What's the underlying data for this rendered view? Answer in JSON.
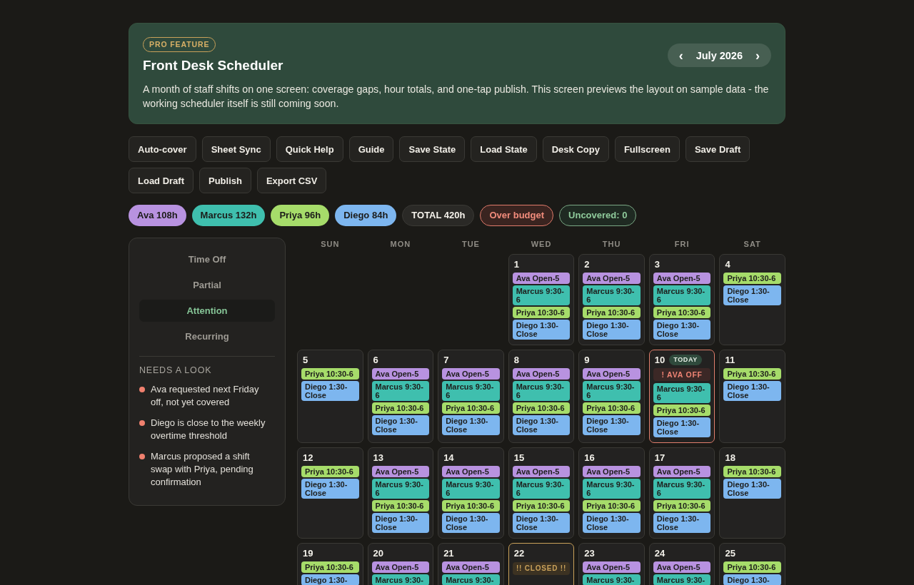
{
  "header": {
    "badge": "PRO FEATURE",
    "title": "Front Desk Scheduler",
    "description": "A month of staff shifts on one screen: coverage gaps, hour totals, and one-tap publish. This screen previews the layout on sample data - the working scheduler itself is still coming soon.",
    "month_nav": {
      "prev": "‹",
      "label": "July 2026",
      "next": "›"
    }
  },
  "toolbar": [
    "Auto-cover",
    "Sheet Sync",
    "Quick Help",
    "Guide",
    "Save State",
    "Load State",
    "Desk Copy",
    "Fullscreen",
    "Save Draft",
    "Load Draft",
    "Publish",
    "Export CSV"
  ],
  "hour_chips": [
    {
      "kind": "staff",
      "label": "Ava 108h",
      "color": "#b892e0"
    },
    {
      "kind": "staff",
      "label": "Marcus 132h",
      "color": "#3fbfae"
    },
    {
      "kind": "staff",
      "label": "Priya 96h",
      "color": "#a6dc6a"
    },
    {
      "kind": "staff",
      "label": "Diego 84h",
      "color": "#7db6ef"
    },
    {
      "kind": "total",
      "label": "TOTAL 420h"
    },
    {
      "kind": "alert",
      "label": "Over budget"
    },
    {
      "kind": "ok",
      "label": "Uncovered: 0"
    }
  ],
  "sidebar": {
    "filters": [
      {
        "label": "Time Off",
        "selected": false
      },
      {
        "label": "Partial",
        "selected": false
      },
      {
        "label": "Attention",
        "selected": true
      },
      {
        "label": "Recurring",
        "selected": false
      }
    ],
    "notices_heading": "NEEDS A LOOK",
    "notices": [
      "Ava requested next Friday off, not yet covered",
      "Diego is close to the weekly overtime threshold",
      "Marcus proposed a shift swap with Priya, pending confirmation"
    ]
  },
  "calendar": {
    "weekdays": [
      "SUN",
      "MON",
      "TUE",
      "WED",
      "THU",
      "FRI",
      "SAT"
    ],
    "weeks": [
      [
        {
          "kind": "blank"
        },
        {
          "kind": "blank"
        },
        {
          "kind": "blank"
        },
        {
          "kind": "day",
          "day": "1",
          "shifts": [
            {
              "kind": "shift",
              "label": "Ava Open-5",
              "color": "#b892e0"
            },
            {
              "kind": "shift",
              "label": "Marcus 9:30-6",
              "color": "#3fbfae"
            },
            {
              "kind": "shift",
              "label": "Priya 10:30-6",
              "color": "#a6dc6a"
            },
            {
              "kind": "shift",
              "label": "Diego 1:30-Close",
              "color": "#7db6ef"
            }
          ]
        },
        {
          "kind": "day",
          "day": "2",
          "shifts": [
            {
              "kind": "shift",
              "label": "Ava Open-5",
              "color": "#b892e0"
            },
            {
              "kind": "shift",
              "label": "Marcus 9:30-6",
              "color": "#3fbfae"
            },
            {
              "kind": "shift",
              "label": "Priya 10:30-6",
              "color": "#a6dc6a"
            },
            {
              "kind": "shift",
              "label": "Diego 1:30-Close",
              "color": "#7db6ef"
            }
          ]
        },
        {
          "kind": "day",
          "day": "3",
          "shifts": [
            {
              "kind": "shift",
              "label": "Ava Open-5",
              "color": "#b892e0"
            },
            {
              "kind": "shift",
              "label": "Marcus 9:30-6",
              "color": "#3fbfae"
            },
            {
              "kind": "shift",
              "label": "Priya 10:30-6",
              "color": "#a6dc6a"
            },
            {
              "kind": "shift",
              "label": "Diego 1:30-Close",
              "color": "#7db6ef"
            }
          ]
        },
        {
          "kind": "day",
          "day": "4",
          "shifts": [
            {
              "kind": "shift",
              "label": "Priya 10:30-6",
              "color": "#a6dc6a"
            },
            {
              "kind": "shift",
              "label": "Diego 1:30-Close",
              "color": "#7db6ef"
            }
          ]
        }
      ],
      [
        {
          "kind": "day",
          "day": "5",
          "shifts": [
            {
              "kind": "shift",
              "label": "Priya 10:30-6",
              "color": "#a6dc6a"
            },
            {
              "kind": "shift",
              "label": "Diego 1:30-Close",
              "color": "#7db6ef"
            }
          ]
        },
        {
          "kind": "day",
          "day": "6",
          "shifts": [
            {
              "kind": "shift",
              "label": "Ava Open-5",
              "color": "#b892e0"
            },
            {
              "kind": "shift",
              "label": "Marcus 9:30-6",
              "color": "#3fbfae"
            },
            {
              "kind": "shift",
              "label": "Priya 10:30-6",
              "color": "#a6dc6a"
            },
            {
              "kind": "shift",
              "label": "Diego 1:30-Close",
              "color": "#7db6ef"
            }
          ]
        },
        {
          "kind": "day",
          "day": "7",
          "shifts": [
            {
              "kind": "shift",
              "label": "Ava Open-5",
              "color": "#b892e0"
            },
            {
              "kind": "shift",
              "label": "Marcus 9:30-6",
              "color": "#3fbfae"
            },
            {
              "kind": "shift",
              "label": "Priya 10:30-6",
              "color": "#a6dc6a"
            },
            {
              "kind": "shift",
              "label": "Diego 1:30-Close",
              "color": "#7db6ef"
            }
          ]
        },
        {
          "kind": "day",
          "day": "8",
          "shifts": [
            {
              "kind": "shift",
              "label": "Ava Open-5",
              "color": "#b892e0"
            },
            {
              "kind": "shift",
              "label": "Marcus 9:30-6",
              "color": "#3fbfae"
            },
            {
              "kind": "shift",
              "label": "Priya 10:30-6",
              "color": "#a6dc6a"
            },
            {
              "kind": "shift",
              "label": "Diego 1:30-Close",
              "color": "#7db6ef"
            }
          ]
        },
        {
          "kind": "day",
          "day": "9",
          "shifts": [
            {
              "kind": "shift",
              "label": "Ava Open-5",
              "color": "#b892e0"
            },
            {
              "kind": "shift",
              "label": "Marcus 9:30-6",
              "color": "#3fbfae"
            },
            {
              "kind": "shift",
              "label": "Priya 10:30-6",
              "color": "#a6dc6a"
            },
            {
              "kind": "shift",
              "label": "Diego 1:30-Close",
              "color": "#7db6ef"
            }
          ]
        },
        {
          "kind": "today",
          "day": "10",
          "badge": "TODAY",
          "shifts": [
            {
              "kind": "alert",
              "label": "! AVA OFF"
            },
            {
              "kind": "shift",
              "label": "Marcus 9:30-6",
              "color": "#3fbfae"
            },
            {
              "kind": "shift",
              "label": "Priya 10:30-6",
              "color": "#a6dc6a"
            },
            {
              "kind": "shift",
              "label": "Diego 1:30-Close",
              "color": "#7db6ef"
            }
          ]
        },
        {
          "kind": "day",
          "day": "11",
          "shifts": [
            {
              "kind": "shift",
              "label": "Priya 10:30-6",
              "color": "#a6dc6a"
            },
            {
              "kind": "shift",
              "label": "Diego 1:30-Close",
              "color": "#7db6ef"
            }
          ]
        }
      ],
      [
        {
          "kind": "day",
          "day": "12",
          "shifts": [
            {
              "kind": "shift",
              "label": "Priya 10:30-6",
              "color": "#a6dc6a"
            },
            {
              "kind": "shift",
              "label": "Diego 1:30-Close",
              "color": "#7db6ef"
            }
          ]
        },
        {
          "kind": "day",
          "day": "13",
          "shifts": [
            {
              "kind": "shift",
              "label": "Ava Open-5",
              "color": "#b892e0"
            },
            {
              "kind": "shift",
              "label": "Marcus 9:30-6",
              "color": "#3fbfae"
            },
            {
              "kind": "shift",
              "label": "Priya 10:30-6",
              "color": "#a6dc6a"
            },
            {
              "kind": "shift",
              "label": "Diego 1:30-Close",
              "color": "#7db6ef"
            }
          ]
        },
        {
          "kind": "day",
          "day": "14",
          "shifts": [
            {
              "kind": "shift",
              "label": "Ava Open-5",
              "color": "#b892e0"
            },
            {
              "kind": "shift",
              "label": "Marcus 9:30-6",
              "color": "#3fbfae"
            },
            {
              "kind": "shift",
              "label": "Priya 10:30-6",
              "color": "#a6dc6a"
            },
            {
              "kind": "shift",
              "label": "Diego 1:30-Close",
              "color": "#7db6ef"
            }
          ]
        },
        {
          "kind": "day",
          "day": "15",
          "shifts": [
            {
              "kind": "shift",
              "label": "Ava Open-5",
              "color": "#b892e0"
            },
            {
              "kind": "shift",
              "label": "Marcus 9:30-6",
              "color": "#3fbfae"
            },
            {
              "kind": "shift",
              "label": "Priya 10:30-6",
              "color": "#a6dc6a"
            },
            {
              "kind": "shift",
              "label": "Diego 1:30-Close",
              "color": "#7db6ef"
            }
          ]
        },
        {
          "kind": "day",
          "day": "16",
          "shifts": [
            {
              "kind": "shift",
              "label": "Ava Open-5",
              "color": "#b892e0"
            },
            {
              "kind": "shift",
              "label": "Marcus 9:30-6",
              "color": "#3fbfae"
            },
            {
              "kind": "shift",
              "label": "Priya 10:30-6",
              "color": "#a6dc6a"
            },
            {
              "kind": "shift",
              "label": "Diego 1:30-Close",
              "color": "#7db6ef"
            }
          ]
        },
        {
          "kind": "day",
          "day": "17",
          "shifts": [
            {
              "kind": "shift",
              "label": "Ava Open-5",
              "color": "#b892e0"
            },
            {
              "kind": "shift",
              "label": "Marcus 9:30-6",
              "color": "#3fbfae"
            },
            {
              "kind": "shift",
              "label": "Priya 10:30-6",
              "color": "#a6dc6a"
            },
            {
              "kind": "shift",
              "label": "Diego 1:30-Close",
              "color": "#7db6ef"
            }
          ]
        },
        {
          "kind": "day",
          "day": "18",
          "shifts": [
            {
              "kind": "shift",
              "label": "Priya 10:30-6",
              "color": "#a6dc6a"
            },
            {
              "kind": "shift",
              "label": "Diego 1:30-Close",
              "color": "#7db6ef"
            }
          ]
        }
      ],
      [
        {
          "kind": "day",
          "day": "19",
          "shifts": [
            {
              "kind": "shift",
              "label": "Priya 10:30-6",
              "color": "#a6dc6a"
            },
            {
              "kind": "shift",
              "label": "Diego 1:30-",
              "color": "#7db6ef"
            }
          ]
        },
        {
          "kind": "day",
          "day": "20",
          "shifts": [
            {
              "kind": "shift",
              "label": "Ava Open-5",
              "color": "#b892e0"
            },
            {
              "kind": "shift",
              "label": "Marcus 9:30-",
              "color": "#3fbfae"
            }
          ]
        },
        {
          "kind": "day",
          "day": "21",
          "shifts": [
            {
              "kind": "shift",
              "label": "Ava Open-5",
              "color": "#b892e0"
            },
            {
              "kind": "shift",
              "label": "Marcus 9:30-",
              "color": "#3fbfae"
            }
          ]
        },
        {
          "kind": "closed",
          "day": "22",
          "shifts": [
            {
              "kind": "closed",
              "label": "!! CLOSED !!"
            }
          ]
        },
        {
          "kind": "day",
          "day": "23",
          "shifts": [
            {
              "kind": "shift",
              "label": "Ava Open-5",
              "color": "#b892e0"
            },
            {
              "kind": "shift",
              "label": "Marcus 9:30-",
              "color": "#3fbfae"
            }
          ]
        },
        {
          "kind": "day",
          "day": "24",
          "shifts": [
            {
              "kind": "shift",
              "label": "Ava Open-5",
              "color": "#b892e0"
            },
            {
              "kind": "shift",
              "label": "Marcus 9:30-",
              "color": "#3fbfae"
            }
          ]
        },
        {
          "kind": "day",
          "day": "25",
          "shifts": [
            {
              "kind": "shift",
              "label": "Priya 10:30-6",
              "color": "#a6dc6a"
            },
            {
              "kind": "shift",
              "label": "Diego 1:30-",
              "color": "#7db6ef"
            }
          ]
        }
      ]
    ]
  }
}
